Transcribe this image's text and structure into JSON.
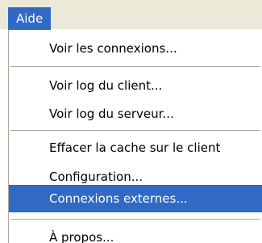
{
  "menubar": {
    "title": "Aide"
  },
  "menu": {
    "items": [
      {
        "label": "Voir les connexions..."
      },
      {
        "label": "Voir log du client..."
      },
      {
        "label": "Voir log du serveur..."
      },
      {
        "label": "Effacer la cache sur le client"
      },
      {
        "label": "Configuration..."
      },
      {
        "label": "Connexions externes..."
      },
      {
        "label": "À propos..."
      }
    ],
    "highlighted_label": "Connexions externes..."
  },
  "colors": {
    "highlight": "#316ac5",
    "menubar_bg": "#ece9d8",
    "separator": "#aca899"
  }
}
